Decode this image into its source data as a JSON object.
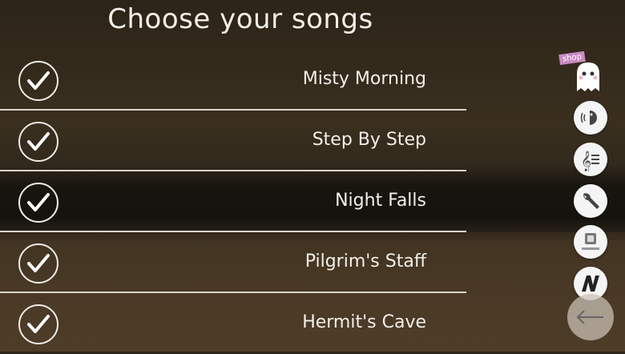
{
  "title": "Choose your songs",
  "songs": [
    {
      "name": "Misty Morning",
      "checked": true
    },
    {
      "name": "Step By Step",
      "checked": true
    },
    {
      "name": "Night Falls",
      "checked": true
    },
    {
      "name": "Pilgrim's Staff",
      "checked": true
    },
    {
      "name": "Hermit's Cave",
      "checked": true
    }
  ],
  "sidebar": {
    "shop_label": "shop",
    "icons": [
      "shop-ghost-icon",
      "sound-icon",
      "music-notes-icon",
      "wrench-icon",
      "more-apps-icon",
      "n-logo-icon",
      "back-arrow-icon"
    ]
  },
  "colors": {
    "text": "#f3efe8",
    "divider": "#d9d4cc",
    "shop_tag": "#c98ac3"
  }
}
